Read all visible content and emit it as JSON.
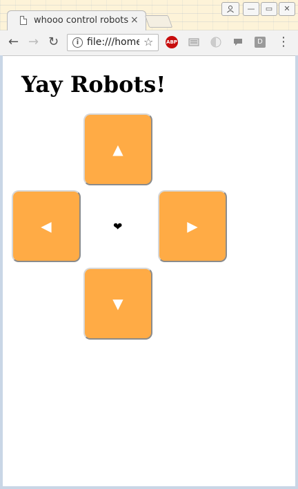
{
  "browser": {
    "tab_title": "whooo control robots",
    "tab_close": "×",
    "url": "file:///home",
    "star": "☆",
    "back": "←",
    "forward": "→",
    "reload": "↻",
    "menu": "⋮",
    "abp_label": "ABP",
    "ext_d_label": "D",
    "window_controls": {
      "user": "👤",
      "minimize": "—",
      "maximize": "▭",
      "close": "✕"
    }
  },
  "page": {
    "heading": "Yay Robots!",
    "buttons": {
      "up": "▲",
      "left": "◀",
      "right": "▶",
      "down": "▼"
    },
    "center_icon": "❤"
  },
  "colors": {
    "button_bg": "#ffab45",
    "button_border": "#8b8b8b",
    "abp_red": "#c70d0d"
  }
}
